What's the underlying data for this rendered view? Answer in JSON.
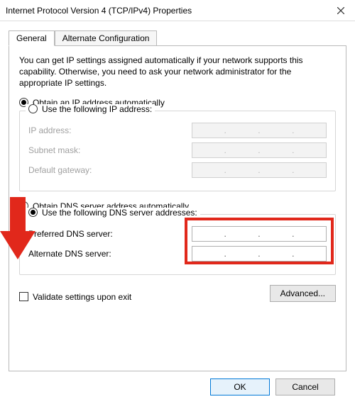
{
  "window": {
    "title": "Internet Protocol Version 4 (TCP/IPv4) Properties",
    "close_tooltip": "Close"
  },
  "tabs": {
    "general": "General",
    "alternate": "Alternate Configuration"
  },
  "description": "You can get IP settings assigned automatically if your network supports this capability. Otherwise, you need to ask your network administrator for the appropriate IP settings.",
  "ip": {
    "auto_label": "Obtain an IP address automatically",
    "manual_label": "Use the following IP address:",
    "ip_address_label": "IP address:",
    "subnet_label": "Subnet mask:",
    "gateway_label": "Default gateway:"
  },
  "dns": {
    "auto_label": "Obtain DNS server address automatically",
    "manual_label": "Use the following DNS server addresses:",
    "preferred_label": "Preferred DNS server:",
    "alternate_label": "Alternate DNS server:"
  },
  "validate_label": "Validate settings upon exit",
  "buttons": {
    "advanced": "Advanced...",
    "ok": "OK",
    "cancel": "Cancel"
  }
}
